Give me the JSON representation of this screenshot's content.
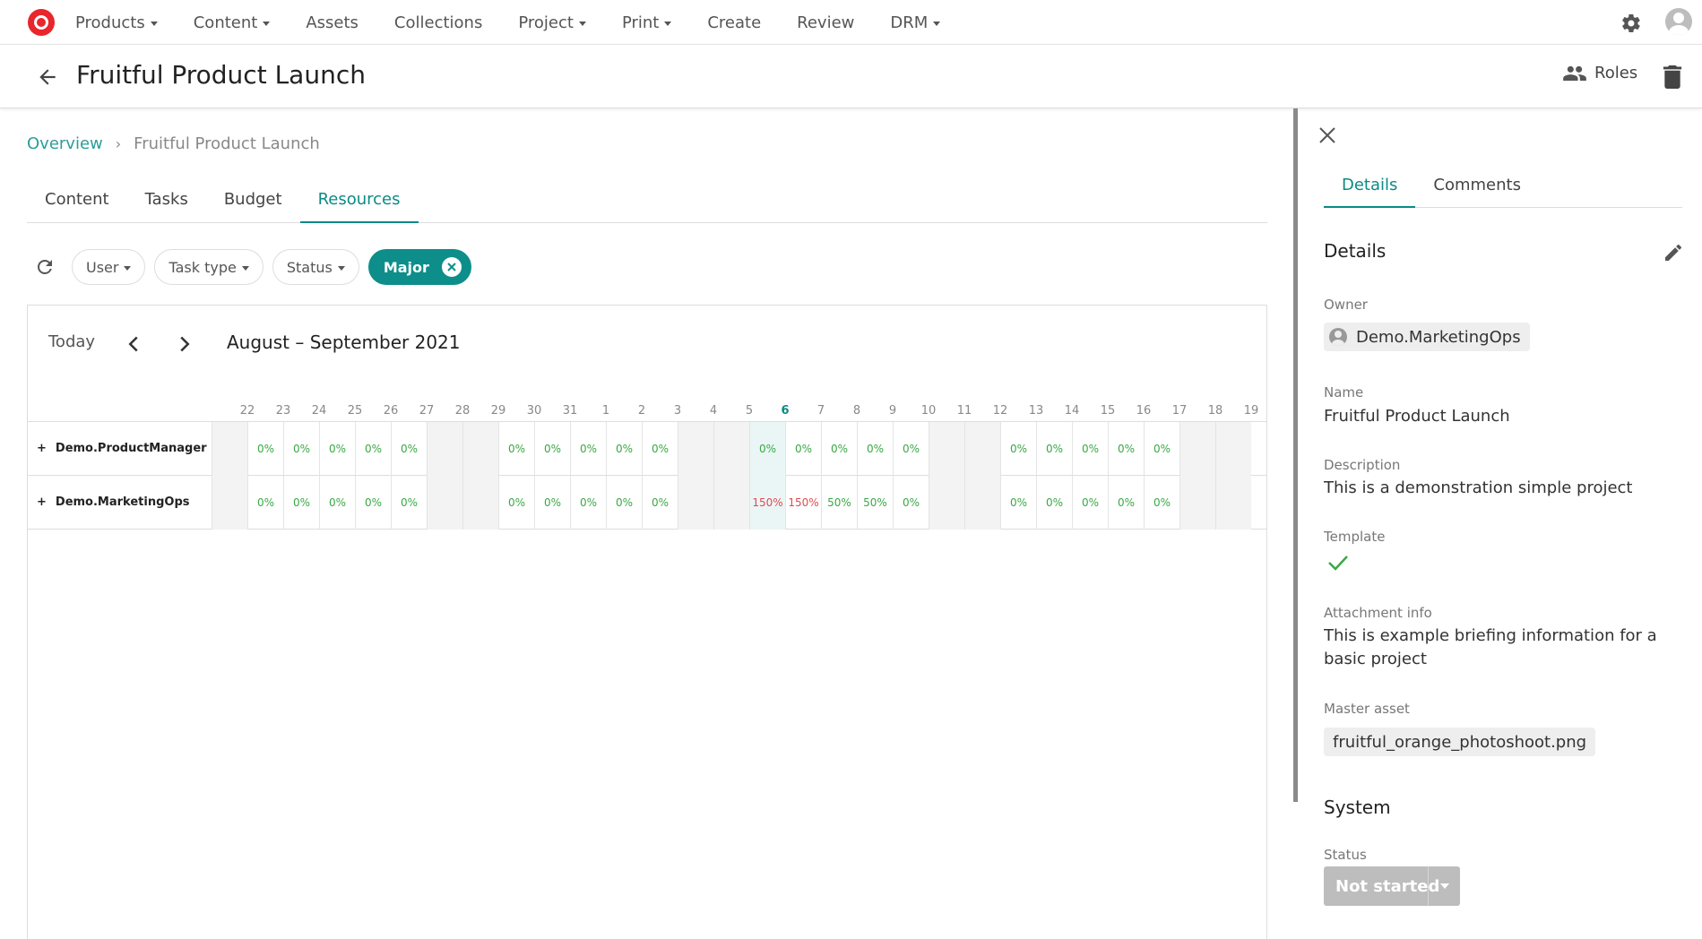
{
  "nav": {
    "items": [
      {
        "label": "Products",
        "dropdown": true
      },
      {
        "label": "Content",
        "dropdown": true
      },
      {
        "label": "Assets",
        "dropdown": false
      },
      {
        "label": "Collections",
        "dropdown": false
      },
      {
        "label": "Project",
        "dropdown": true
      },
      {
        "label": "Print",
        "dropdown": true
      },
      {
        "label": "Create",
        "dropdown": false
      },
      {
        "label": "Review",
        "dropdown": false
      },
      {
        "label": "DRM",
        "dropdown": true
      }
    ],
    "icons": {
      "settings": "gear-icon",
      "user": "user-avatar-icon",
      "logo": "brand-logo-icon"
    }
  },
  "header": {
    "title": "Fruitful Product Launch",
    "roles_label": "Roles"
  },
  "breadcrumb": {
    "root": "Overview",
    "current": "Fruitful Product Launch"
  },
  "tabs": [
    {
      "label": "Content",
      "active": false
    },
    {
      "label": "Tasks",
      "active": false
    },
    {
      "label": "Budget",
      "active": false
    },
    {
      "label": "Resources",
      "active": true
    }
  ],
  "filters": {
    "user": "User",
    "task_type": "Task type",
    "status": "Status",
    "active_filter": "Major"
  },
  "calendar": {
    "today_label": "Today",
    "title": "August – September 2021",
    "days": [
      "22",
      "23",
      "24",
      "25",
      "26",
      "27",
      "28",
      "29",
      "30",
      "31",
      "1",
      "2",
      "3",
      "4",
      "5",
      "6",
      "7",
      "8",
      "9",
      "10",
      "11",
      "12",
      "13",
      "14",
      "15",
      "16",
      "17",
      "18",
      "19"
    ],
    "today_index": 15,
    "weekend_indices": [
      0,
      6,
      7,
      13,
      14,
      20,
      21,
      27,
      28
    ],
    "rows": [
      {
        "name": "Demo.ProductManager",
        "values": [
          "",
          "0%",
          "0%",
          "0%",
          "0%",
          "0%",
          "",
          "",
          "0%",
          "0%",
          "0%",
          "0%",
          "0%",
          "",
          "",
          "0%",
          "0%",
          "0%",
          "0%",
          "0%",
          "",
          "",
          "0%",
          "0%",
          "0%",
          "0%",
          "0%",
          "",
          ""
        ]
      },
      {
        "name": "Demo.MarketingOps",
        "values": [
          "",
          "0%",
          "0%",
          "0%",
          "0%",
          "0%",
          "",
          "",
          "0%",
          "0%",
          "0%",
          "0%",
          "0%",
          "",
          "",
          "150%",
          "150%",
          "50%",
          "50%",
          "0%",
          "",
          "",
          "0%",
          "0%",
          "0%",
          "0%",
          "0%",
          "",
          ""
        ]
      }
    ],
    "colors": {
      "ok": "#3aa845",
      "over": "#e5484d",
      "accent": "#0b8a86"
    }
  },
  "panel": {
    "tabs": [
      {
        "label": "Details",
        "active": true
      },
      {
        "label": "Comments",
        "active": false
      }
    ],
    "details_title": "Details",
    "owner_label": "Owner",
    "owner_value": "Demo.MarketingOps",
    "name_label": "Name",
    "name_value": "Fruitful Product Launch",
    "description_label": "Description",
    "description_value": "This is a demonstration simple project",
    "template_label": "Template",
    "template_value": "check-icon",
    "attachment_label": "Attachment info",
    "attachment_value": "This is example briefing information for a basic project",
    "master_asset_label": "Master asset",
    "master_asset_value": "fruitful_orange_photoshoot.png",
    "system_title": "System",
    "status_label": "Status",
    "status_value": "Not started"
  }
}
